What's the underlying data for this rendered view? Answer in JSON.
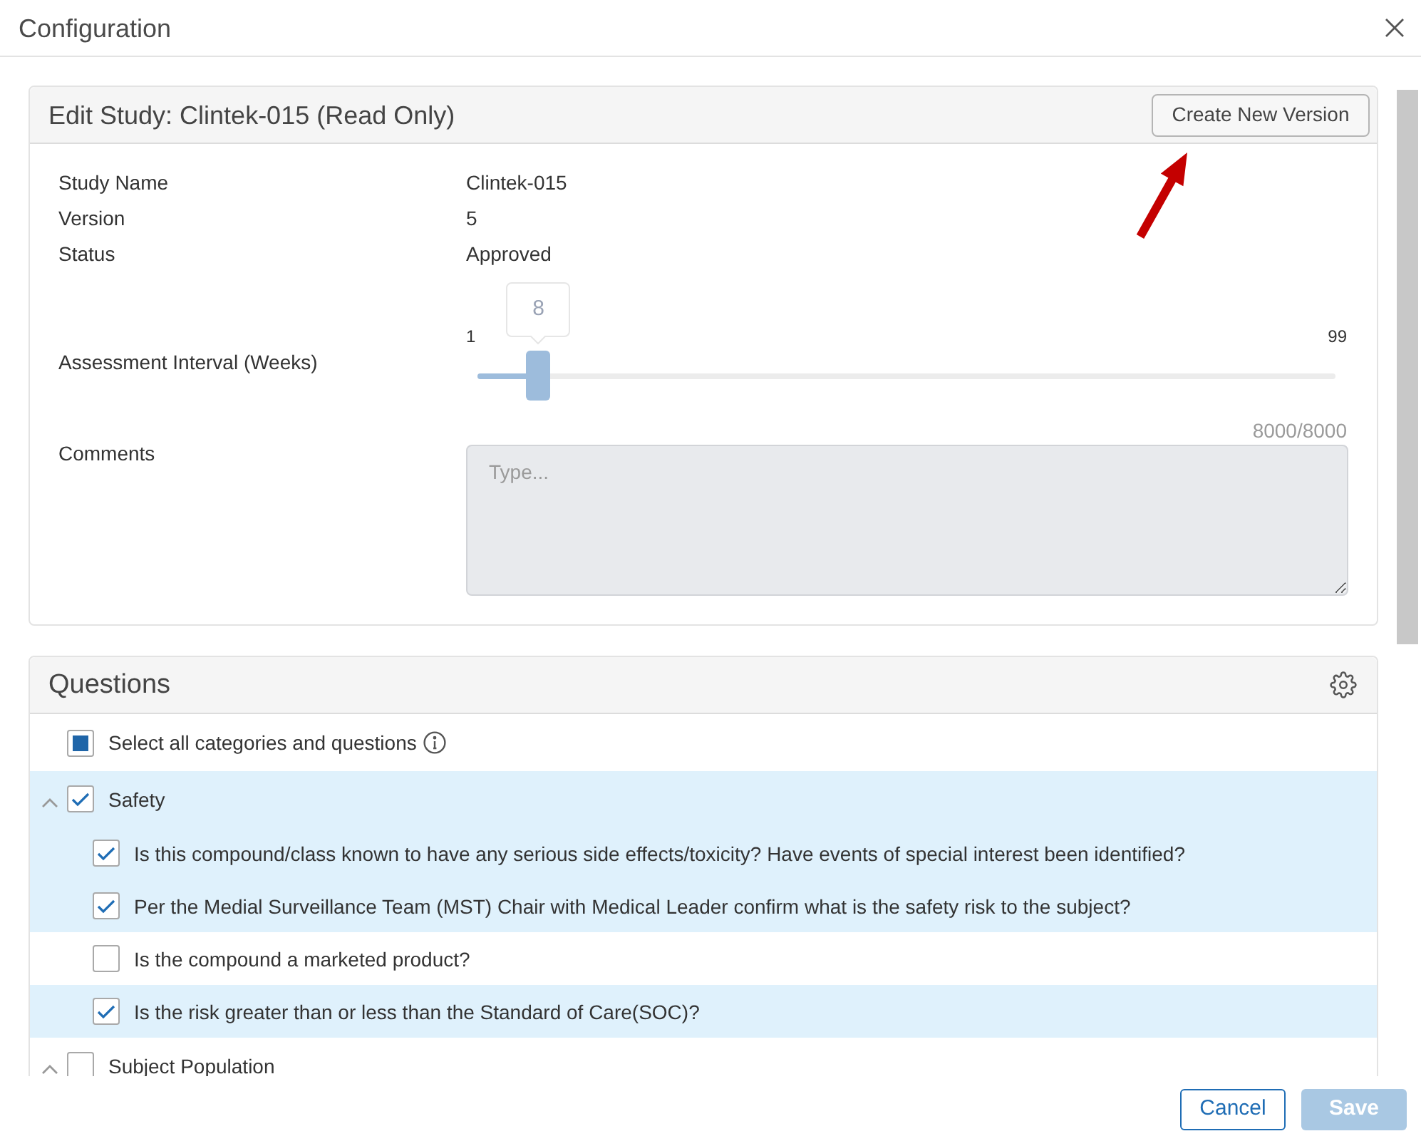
{
  "window": {
    "title": "Configuration"
  },
  "study_card": {
    "title": "Edit Study: Clintek-015 (Read Only)",
    "action_button": "Create New Version",
    "fields": [
      {
        "label": "Study Name",
        "value": "Clintek-015"
      },
      {
        "label": "Version",
        "value": "5"
      },
      {
        "label": "Status",
        "value": "Approved"
      }
    ],
    "interval": {
      "label": "Assessment Interval (Weeks)",
      "min_label": "1",
      "max_label": "99",
      "value_label": "8",
      "level": 0.071
    },
    "comments": {
      "label": "Comments",
      "counter": "8000/8000",
      "placeholder": "Type..."
    }
  },
  "questions_card": {
    "title": "Questions",
    "select_all": {
      "label": "Select all categories and questions",
      "checked": false,
      "indeterminate": true
    },
    "categories": [
      {
        "label": "Safety",
        "expanded": true,
        "checked": true,
        "children": [
          {
            "label": "Is this compound/class known to have any serious side effects/toxicity? Have events of special interest been identified?",
            "checked": true
          },
          {
            "label": "Per the Medial Surveillance Team (MST) Chair with Medical Leader confirm what is the safety risk to the subject?",
            "checked": true
          },
          {
            "label": "Is the compound a marketed product?",
            "checked": false
          },
          {
            "label": "Is the risk greater than or less than the Standard of Care(SOC)?",
            "checked": true
          }
        ]
      },
      {
        "label": "Subject Population",
        "expanded": true,
        "checked": false
      }
    ]
  },
  "footer": {
    "buttons": [
      {
        "label": "Cancel",
        "kind": "secondary",
        "disabled": false
      },
      {
        "label": "Save",
        "kind": "primary",
        "disabled": true
      }
    ]
  }
}
